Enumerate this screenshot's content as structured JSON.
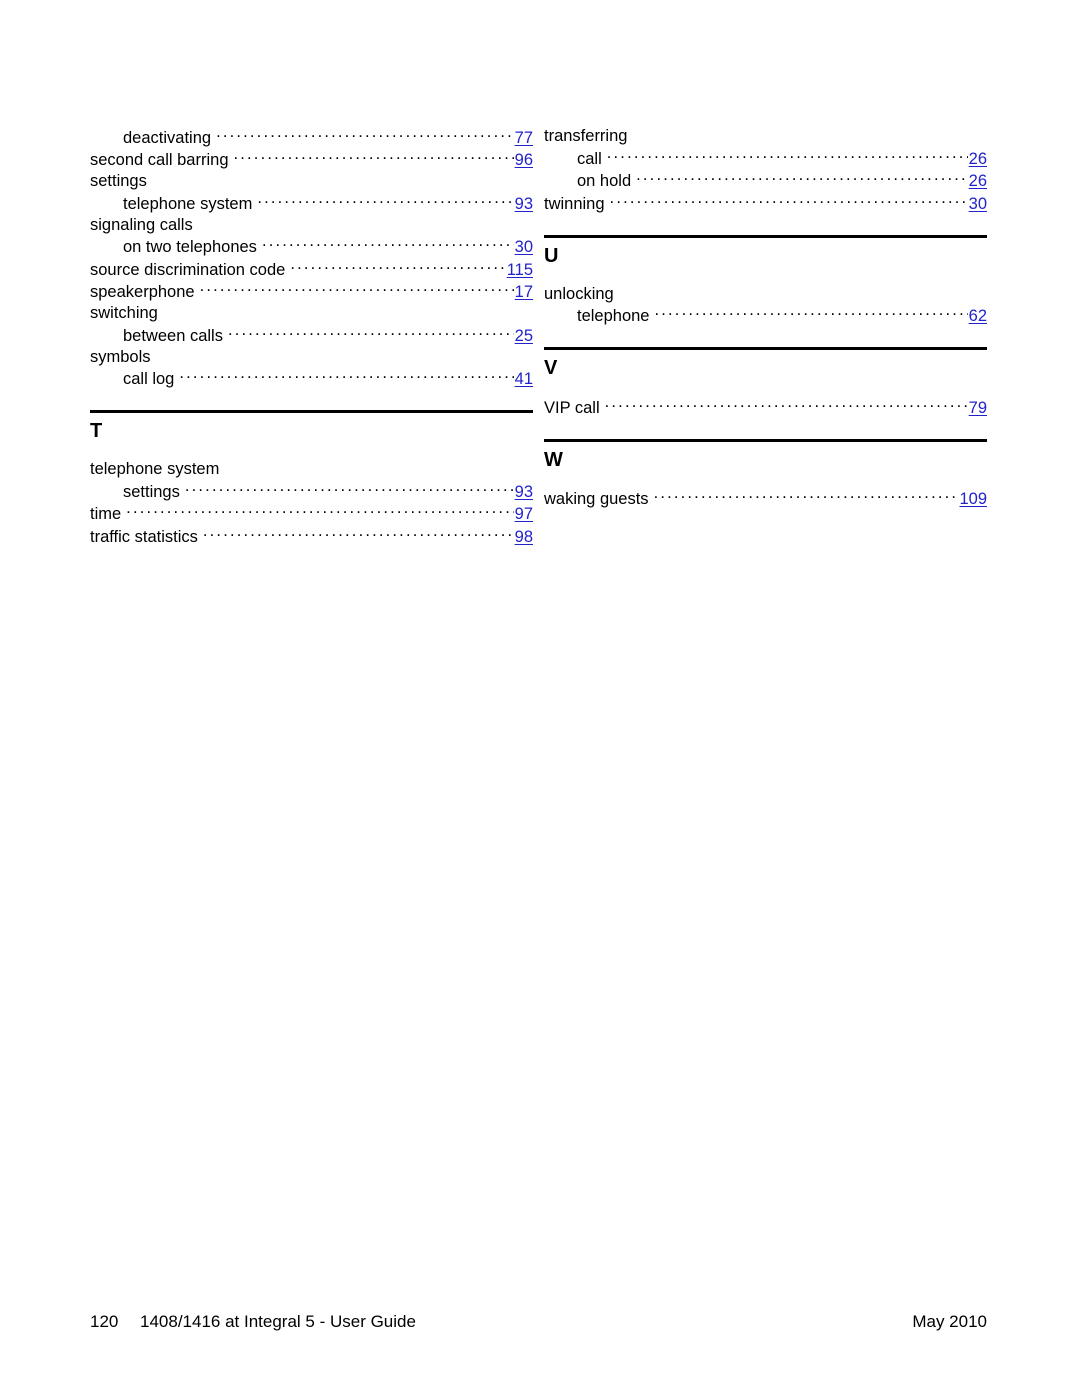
{
  "document": {
    "type": "book-index",
    "page_label": "120"
  },
  "link_color": "#2222cc",
  "columns": [
    {
      "name": "left-column",
      "blocks": [
        {
          "type": "entries",
          "entries": [
            {
              "label": "deactivating",
              "page": "77",
              "level": 1
            },
            {
              "label": "second call barring",
              "page": "96",
              "level": 0
            },
            {
              "label": "settings",
              "page": "",
              "level": 0
            },
            {
              "label": "telephone system",
              "page": "93",
              "level": 1
            },
            {
              "label": "signaling calls",
              "page": "",
              "level": 0
            },
            {
              "label": "on two telephones",
              "page": "30",
              "level": 1
            },
            {
              "label": "source discrimination code",
              "page": "115",
              "level": 0
            },
            {
              "label": "speakerphone",
              "page": "17",
              "level": 0
            },
            {
              "label": "switching",
              "page": "",
              "level": 0
            },
            {
              "label": "between calls",
              "page": "25",
              "level": 1
            },
            {
              "label": "symbols",
              "page": "",
              "level": 0
            },
            {
              "label": "call log",
              "page": "41",
              "level": 1
            }
          ]
        },
        {
          "type": "letter-section",
          "letter": "T",
          "entries": [
            {
              "label": "telephone system",
              "page": "",
              "level": 0
            },
            {
              "label": "settings",
              "page": "93",
              "level": 1
            },
            {
              "label": "time",
              "page": "97",
              "level": 0
            },
            {
              "label": "traffic statistics",
              "page": "98",
              "level": 0
            }
          ]
        }
      ]
    },
    {
      "name": "right-column",
      "blocks": [
        {
          "type": "entries",
          "entries": [
            {
              "label": "transferring",
              "page": "",
              "level": 0
            },
            {
              "label": "call",
              "page": "26",
              "level": 1
            },
            {
              "label": "on hold",
              "page": "26",
              "level": 1
            },
            {
              "label": "twinning",
              "page": "30",
              "level": 0
            }
          ]
        },
        {
          "type": "letter-section",
          "letter": "U",
          "entries": [
            {
              "label": "unlocking",
              "page": "",
              "level": 0
            },
            {
              "label": "telephone",
              "page": "62",
              "level": 1
            }
          ]
        },
        {
          "type": "letter-section",
          "letter": "V",
          "entries": [
            {
              "label": "VIP call",
              "page": "79",
              "level": 0
            }
          ]
        },
        {
          "type": "letter-section",
          "letter": "W",
          "entries": [
            {
              "label": "waking guests",
              "page": "109",
              "level": 0
            }
          ]
        }
      ]
    }
  ],
  "footer": {
    "page_number": "120",
    "title": "1408/1416 at Integral 5 - User Guide",
    "date": "May 2010"
  }
}
